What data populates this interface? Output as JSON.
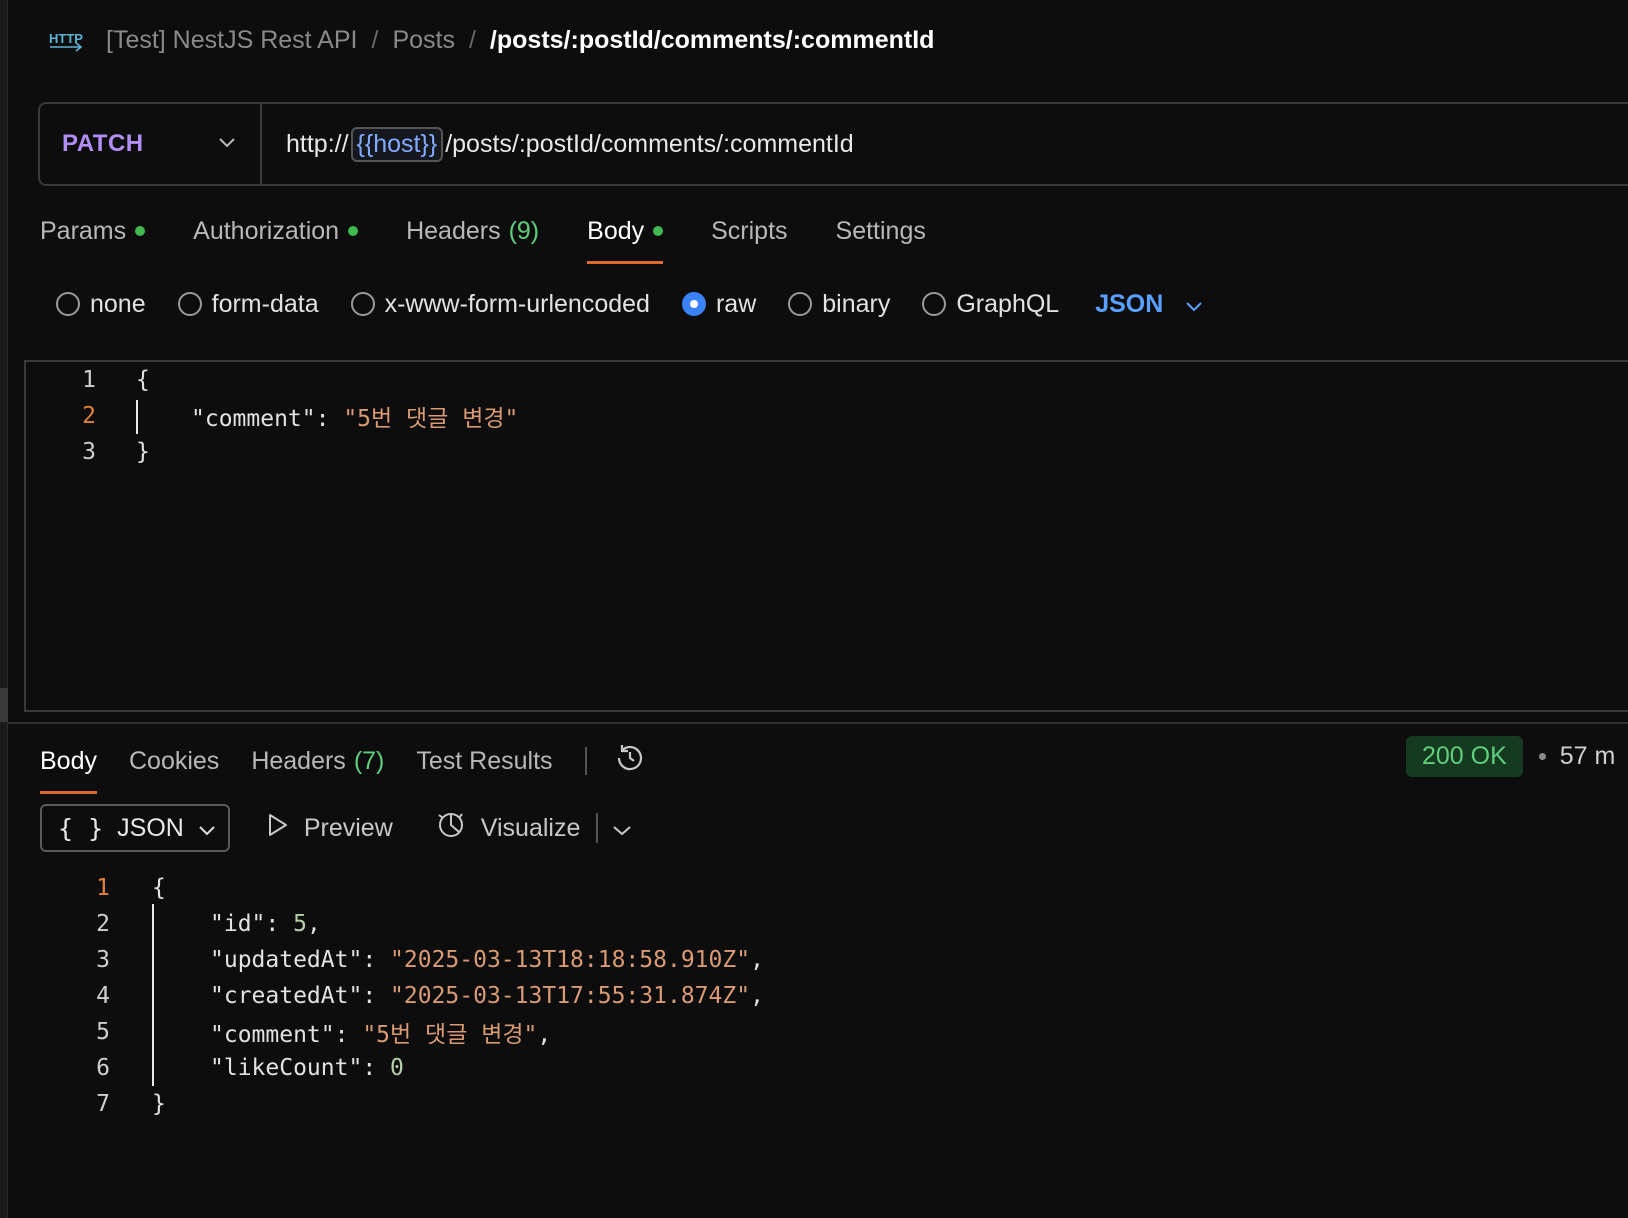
{
  "breadcrumb": {
    "collection": "[Test] NestJS Rest API",
    "folder": "Posts",
    "request": "/posts/:postId/comments/:commentId",
    "separator": "/"
  },
  "request": {
    "method": "PATCH",
    "url_prefix": "http://",
    "url_variable": "{{host}}",
    "url_suffix": "/posts/:postId/comments/:commentId",
    "tabs": [
      {
        "label": "Params",
        "dot": true
      },
      {
        "label": "Authorization",
        "dot": true
      },
      {
        "label": "Headers",
        "count": "(9)"
      },
      {
        "label": "Body",
        "dot": true,
        "active": true
      },
      {
        "label": "Scripts"
      },
      {
        "label": "Settings"
      }
    ],
    "body_types": [
      "none",
      "form-data",
      "x-www-form-urlencoded",
      "raw",
      "binary",
      "GraphQL"
    ],
    "selected_body_type": "raw",
    "language": "JSON",
    "body_lines": [
      {
        "n": "1",
        "open": "{"
      },
      {
        "n": "2",
        "key": "\"comment\"",
        "colon": ": ",
        "value": "\"5번 댓글 변경\""
      },
      {
        "n": "3",
        "close": "}"
      }
    ]
  },
  "response": {
    "tabs": [
      {
        "label": "Body",
        "active": true
      },
      {
        "label": "Cookies"
      },
      {
        "label": "Headers",
        "count": "(7)"
      },
      {
        "label": "Test Results"
      }
    ],
    "status": "200 OK",
    "time": "57 m",
    "format": "JSON",
    "format_braces": "{ }",
    "preview_label": "Preview",
    "visualize_label": "Visualize",
    "lines": [
      {
        "n": "1",
        "text": "{"
      },
      {
        "n": "2",
        "key": "\"id\"",
        "value": "5",
        "type": "num",
        "comma": ","
      },
      {
        "n": "3",
        "key": "\"updatedAt\"",
        "value": "\"2025-03-13T18:18:58.910Z\"",
        "type": "str",
        "comma": ","
      },
      {
        "n": "4",
        "key": "\"createdAt\"",
        "value": "\"2025-03-13T17:55:31.874Z\"",
        "type": "str",
        "comma": ","
      },
      {
        "n": "5",
        "key": "\"comment\"",
        "value": "\"5번 댓글 변경\"",
        "type": "str",
        "comma": ","
      },
      {
        "n": "6",
        "key": "\"likeCount\"",
        "value": "0",
        "type": "num",
        "comma": ""
      },
      {
        "n": "7",
        "text": "}"
      }
    ]
  },
  "colors": {
    "method": "#b48ef7",
    "active_tab_underline": "#e06a2c",
    "status_ok": "#5fce7d",
    "string": "#d99a74",
    "number": "#b5cea8",
    "variable": "#82aaff",
    "radio_selected": "#3b82f6"
  },
  "icons": [
    "http-icon",
    "chevron-down-icon",
    "history-icon",
    "play-icon",
    "visualize-icon"
  ]
}
